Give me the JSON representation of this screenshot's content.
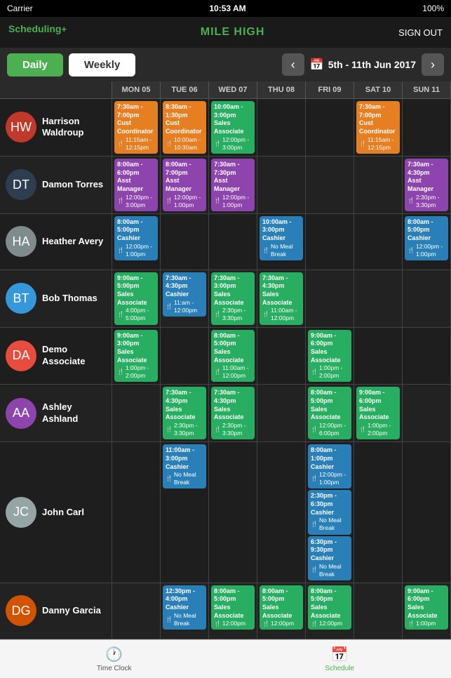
{
  "statusBar": {
    "carrier": "Carrier",
    "time": "10:53 AM",
    "battery": "100%"
  },
  "appHeader": {
    "logo": "Scheduling",
    "logoPlus": "+",
    "location": "MILE HIGH",
    "signOut": "SIGN OUT"
  },
  "tabs": {
    "daily": "Daily",
    "weekly": "Weekly"
  },
  "dateRange": {
    "label": "5th - 11th Jun 2017",
    "prevArrow": "‹",
    "nextArrow": "›"
  },
  "columns": [
    {
      "label": "",
      "key": "name"
    },
    {
      "label": "MON 05",
      "key": "mon"
    },
    {
      "label": "TUE 06",
      "key": "tue"
    },
    {
      "label": "WED 07",
      "key": "wed"
    },
    {
      "label": "THU 08",
      "key": "thu"
    },
    {
      "label": "FRI 09",
      "key": "fri"
    },
    {
      "label": "SAT 10",
      "key": "sat"
    },
    {
      "label": "SUN 11",
      "key": "sun"
    }
  ],
  "employees": [
    {
      "name": "Harrison Waldroup",
      "avatarInitials": "HW",
      "avatarClass": "av-harrison",
      "shifts": {
        "mon": [
          {
            "time": "7:30am - 7:00pm",
            "role": "Cust Coordinator",
            "break": "11:15am - 12:15pm",
            "color": "orange"
          }
        ],
        "tue": [
          {
            "time": "8:30am - 1:30pm",
            "role": "Cust Coordinator",
            "break": "10:00am - 10:30am",
            "color": "orange"
          }
        ],
        "wed": [
          {
            "time": "10:00am - 3:00pm",
            "role": "Sales Associate",
            "break": "12:00pm - 3:00pm",
            "color": "green"
          }
        ],
        "thu": [],
        "fri": [],
        "sat": [
          {
            "time": "7:30am - 7:00pm",
            "role": "Cust Coordinator",
            "break": "11:15am - 12:15pm",
            "color": "orange"
          }
        ],
        "sun": []
      }
    },
    {
      "name": "Damon Torres",
      "avatarInitials": "DT",
      "avatarClass": "av-damon",
      "shifts": {
        "mon": [
          {
            "time": "8:00am - 6:00pm",
            "role": "Asst Manager",
            "break": "12:00pm - 3:00pm",
            "color": "purple"
          }
        ],
        "tue": [
          {
            "time": "8:00am - 7:00pm",
            "role": "Asst Manager",
            "break": "12:00pm - 1:00pm",
            "color": "purple"
          }
        ],
        "wed": [
          {
            "time": "7:30am - 7:30pm",
            "role": "Asst Manager",
            "break": "12:00pm - 1:00pm",
            "color": "purple"
          }
        ],
        "thu": [],
        "fri": [],
        "sat": [],
        "sun": [
          {
            "time": "7:30am - 4:30pm",
            "role": "Asst Manager",
            "break": "2:30pm - 3:30pm",
            "color": "purple"
          }
        ]
      }
    },
    {
      "name": "Heather Avery",
      "avatarInitials": "HA",
      "avatarClass": "av-heather",
      "shifts": {
        "mon": [
          {
            "time": "8:00am - 5:00pm",
            "role": "Cashier",
            "break": "12:00pm - 1:00pm",
            "color": "blue"
          }
        ],
        "tue": [],
        "wed": [],
        "thu": [
          {
            "time": "10:00am - 3:00pm",
            "role": "Cashier",
            "break": "No Meal Break",
            "color": "blue"
          }
        ],
        "fri": [],
        "sat": [],
        "sun": [
          {
            "time": "8:00am - 5:00pm",
            "role": "Cashier",
            "break": "12:00pm - 1:00pm",
            "color": "blue"
          }
        ]
      }
    },
    {
      "name": "Bob Thomas",
      "avatarInitials": "BT",
      "avatarClass": "av-bob",
      "shifts": {
        "mon": [
          {
            "time": "9:00am - 5:00pm",
            "role": "Sales Associate",
            "break": "4:00pm - 5:00pm",
            "color": "green"
          }
        ],
        "tue": [
          {
            "time": "7:30am - 4:30pm",
            "role": "Cashier",
            "break": "11:am - 12:00pm",
            "color": "blue"
          }
        ],
        "wed": [
          {
            "time": "7:30am - 3:00pm",
            "role": "Sales Associate",
            "break": "2:30pm - 3:30pm",
            "color": "green"
          }
        ],
        "thu": [
          {
            "time": "7:30am - 4:30pm",
            "role": "Sales Associate",
            "break": "11:00am - 12:00pm",
            "color": "green"
          }
        ],
        "fri": [],
        "sat": [],
        "sun": []
      }
    },
    {
      "name": "Demo Associate",
      "avatarInitials": "DA",
      "avatarClass": "av-demo",
      "shifts": {
        "mon": [
          {
            "time": "9:00am - 3:00pm",
            "role": "Sales Associate",
            "break": "1:00pm - 2:00pm",
            "color": "green"
          }
        ],
        "tue": [],
        "wed": [
          {
            "time": "8:00am - 5:00pm",
            "role": "Sales Associate",
            "break": "11:00am - 12:00pm",
            "color": "green"
          }
        ],
        "thu": [],
        "fri": [
          {
            "time": "9:00am - 6:00pm",
            "role": "Sales Associate",
            "break": "1:00pm - 2:00pm",
            "color": "green"
          }
        ],
        "sat": [],
        "sun": []
      }
    },
    {
      "name": "Ashley Ashland",
      "avatarInitials": "AA",
      "avatarClass": "av-ashley",
      "shifts": {
        "mon": [],
        "tue": [
          {
            "time": "7:30am - 4:30pm",
            "role": "Sales Associate",
            "break": "2:30pm - 3:30pm",
            "color": "green"
          }
        ],
        "wed": [
          {
            "time": "7:30am - 4:30pm",
            "role": "Sales Associate",
            "break": "2:30pm - 3:30pm",
            "color": "green"
          }
        ],
        "thu": [],
        "fri": [
          {
            "time": "8:00am - 5:00pm",
            "role": "Sales Associate",
            "break": "12:00pm - 6:00pm",
            "color": "green"
          }
        ],
        "sat": [
          {
            "time": "9:00am - 6:00pm",
            "role": "Sales Associate",
            "break": "1:00pm - 2:00pm",
            "color": "green"
          }
        ],
        "sun": []
      }
    },
    {
      "name": "John Carl",
      "avatarInitials": "JC",
      "avatarClass": "av-john",
      "shifts": {
        "mon": [],
        "tue": [
          {
            "time": "11:00am - 3:00pm",
            "role": "Cashier",
            "break": "No Meal Break",
            "color": "blue"
          }
        ],
        "wed": [],
        "thu": [],
        "fri": [
          {
            "time": "8:00am - 1:00pm",
            "role": "Cashier",
            "break": "12:00pm - 1:00pm",
            "color": "blue"
          },
          {
            "time": "2:30pm - 6:30pm",
            "role": "Cashier",
            "break": "No Meal Break",
            "color": "blue"
          },
          {
            "time": "6:30pm - 9:30pm",
            "role": "Cashier",
            "break": "No Meal Break",
            "color": "blue"
          }
        ],
        "sat": [],
        "sun": []
      }
    },
    {
      "name": "Danny Garcia",
      "avatarInitials": "DG",
      "avatarClass": "av-danny",
      "shifts": {
        "mon": [],
        "tue": [
          {
            "time": "12:30pm - 4:00pm",
            "role": "Cashier",
            "break": "No Meal Break",
            "color": "blue"
          }
        ],
        "wed": [
          {
            "time": "8:00am - 5:00pm",
            "role": "Sales Associate",
            "break": "12:00pm",
            "color": "green"
          }
        ],
        "thu": [
          {
            "time": "8:00am - 5:00pm",
            "role": "Sales Associate",
            "break": "12:00pm",
            "color": "green"
          }
        ],
        "fri": [
          {
            "time": "8:00am - 5:00pm",
            "role": "Sales Associate",
            "break": "12:00pm",
            "color": "green"
          }
        ],
        "sat": [],
        "sun": [
          {
            "time": "9:00am - 6:00pm",
            "role": "Sales Associate",
            "break": "1:00pm",
            "color": "green"
          }
        ]
      }
    }
  ],
  "bottomNav": {
    "timeClock": "Time Clock",
    "schedule": "Schedule"
  }
}
